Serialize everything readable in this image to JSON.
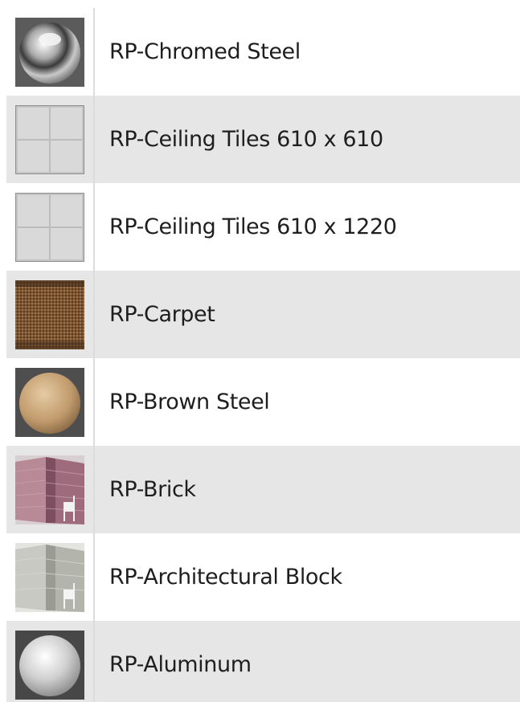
{
  "materials": [
    {
      "name": "RP-Chromed Steel",
      "icon": "chrome-sphere-icon"
    },
    {
      "name": "RP-Ceiling Tiles 610 x 610",
      "icon": "ceiling-tile-icon"
    },
    {
      "name": "RP-Ceiling Tiles 610 x 1220",
      "icon": "ceiling-tile-icon"
    },
    {
      "name": "RP-Carpet",
      "icon": "carpet-cube-icon"
    },
    {
      "name": "RP-Brown Steel",
      "icon": "brown-sphere-icon"
    },
    {
      "name": "RP-Brick",
      "icon": "brick-wall-icon"
    },
    {
      "name": "RP-Architectural Block",
      "icon": "block-wall-icon"
    },
    {
      "name": "RP-Aluminum",
      "icon": "aluminum-sphere-icon"
    }
  ]
}
